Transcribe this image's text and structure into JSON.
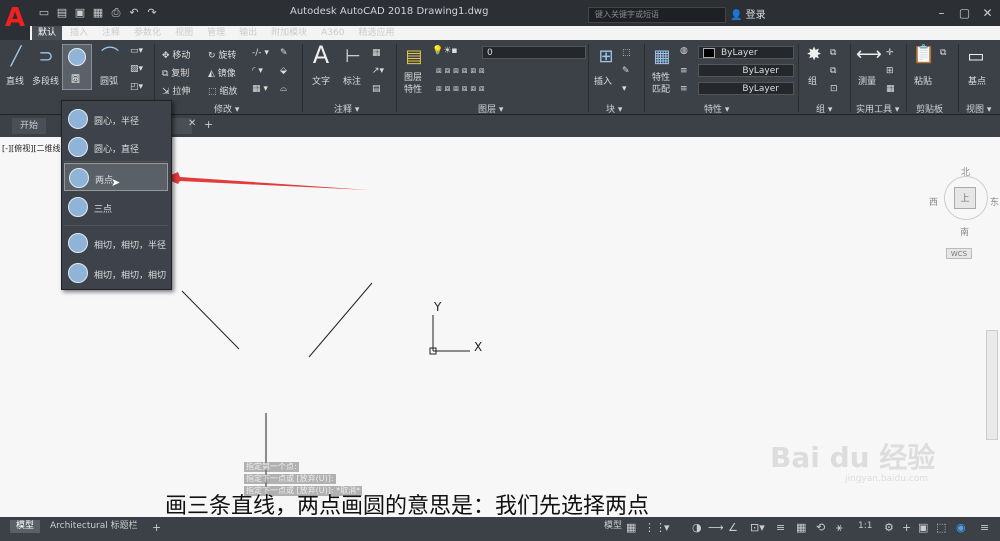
{
  "window": {
    "app_logo": "A",
    "title": "Autodesk AutoCAD 2018    Drawing1.dwg",
    "search_placeholder": "键入关键字或短语",
    "login": "登录"
  },
  "ribbon_tabs": [
    "默认",
    "插入",
    "注释",
    "参数化",
    "视图",
    "管理",
    "输出",
    "附加模块",
    "A360",
    "精选应用"
  ],
  "ribbon": {
    "draw": {
      "line": "直线",
      "polyline": "多段线",
      "circle": "圆",
      "arc": "圆弧"
    },
    "modify": {
      "move": "移动",
      "rotate": "旋转",
      "copy": "复制",
      "mirror": "镜像",
      "stretch": "拉伸",
      "scale": "缩放",
      "panel": "修改"
    },
    "annotation": {
      "text": "文字",
      "dimension": "标注",
      "panel": "注释"
    },
    "layers": {
      "layer_props": "图层\n特性",
      "current_layer": "0",
      "panel": "图层"
    },
    "block": {
      "insert": "插入",
      "panel": "块"
    },
    "properties": {
      "match": "特性\n匹配",
      "color": "ByLayer",
      "linetype": "ByLayer",
      "lineweight": "ByLayer",
      "panel": "特性"
    },
    "groups": {
      "group": "组",
      "panel": "组"
    },
    "utilities": {
      "measure": "测量",
      "panel": "实用工具"
    },
    "clipboard": {
      "paste": "粘贴",
      "panel": "剪贴板"
    },
    "view": {
      "base": "基点",
      "panel": "视图"
    }
  },
  "file_tabs": {
    "start": "开始"
  },
  "viewport_label": "[-][俯视][二维线框]",
  "circle_menu": {
    "items": [
      {
        "label": "圆心，半径"
      },
      {
        "label": "圆心，直径"
      },
      {
        "label": "两点"
      },
      {
        "label": "三点"
      },
      {
        "label": "相切，相切，半径"
      },
      {
        "label": "相切，相切，相切"
      }
    ],
    "highlighted_index": 2
  },
  "viewcube": {
    "north": "北",
    "west": "西",
    "east": "东",
    "south": "南",
    "top": "上",
    "wcs": "WCS"
  },
  "ucs": {
    "x": "X",
    "y": "Y"
  },
  "command_history": [
    "指定第一个点:",
    "指定下一点或 [放弃(U)]:",
    "指定下一点或 [放弃(U)]: *取消*"
  ],
  "subtitle": "画三条直线，两点画圆的意思是：我们先选择两点",
  "watermark": {
    "brand": "Bai du 经验",
    "url": "jingyan.baidu.com"
  },
  "status": {
    "model_tab": "模型",
    "layout_tab": "Architectural 标题栏",
    "model_btn": "模型",
    "scale": "1:1"
  },
  "colors": {
    "accent": "#e22222",
    "ribbon_bg": "#3c4047",
    "arrow": "#e23b3b"
  }
}
